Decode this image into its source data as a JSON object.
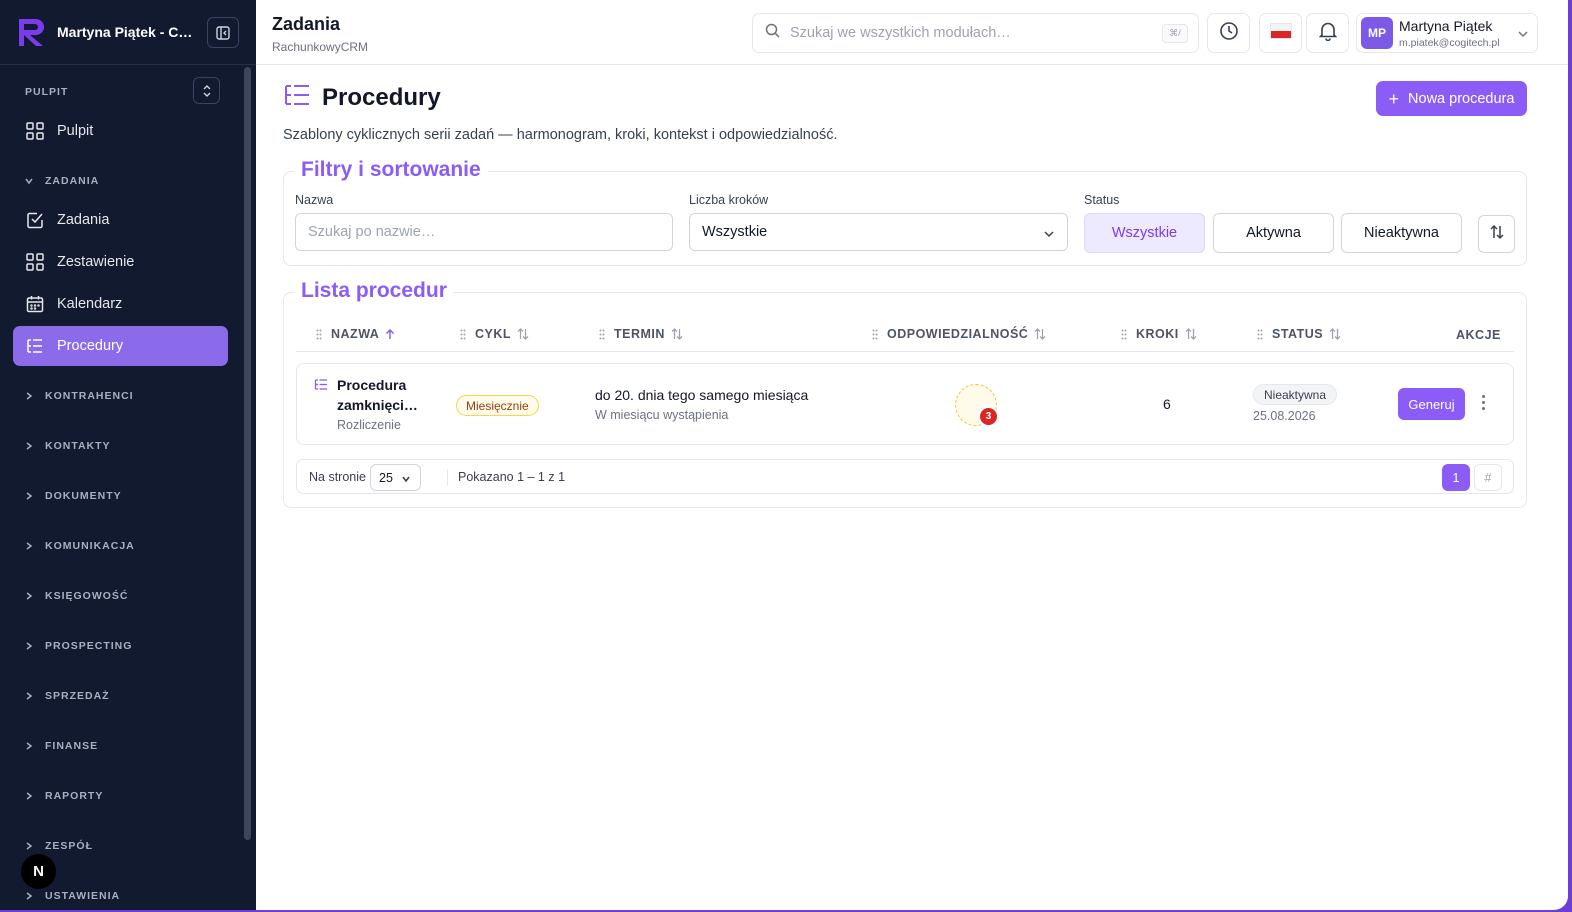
{
  "workspace": {
    "name": "Martyna Piątek - C…"
  },
  "sidebar": {
    "pulpit_label": "PULPIT",
    "pulpit_item": "Pulpit",
    "zadania_label": "ZADANIA",
    "items": [
      {
        "label": "Zadania",
        "icon": "check-square-icon"
      },
      {
        "label": "Zestawienie",
        "icon": "grid-icon"
      },
      {
        "label": "Kalendarz",
        "icon": "calendar-icon"
      },
      {
        "label": "Procedury",
        "icon": "list-tree-icon",
        "active": true
      }
    ],
    "groups": [
      "KONTRAHENCI",
      "KONTAKTY",
      "DOKUMENTY",
      "KOMUNIKACJA",
      "KSIĘGOWOŚĆ",
      "PROSPECTING",
      "SPRZEDAŻ",
      "FINANSE",
      "RAPORTY",
      "ZESPÓŁ",
      "USTAWIENIA"
    ],
    "next_badge": "N"
  },
  "topbar": {
    "title": "Zadania",
    "subtitle": "RachunkowyCRM",
    "search_placeholder": "Szukaj we wszystkich modułach…",
    "search_shortcut": "⌘/",
    "user_initials": "MP",
    "user_name": "Martyna Piątek",
    "user_email": "m.piatek@cogitech.pl"
  },
  "page": {
    "title": "Procedury",
    "description": "Szablony cyklicznych serii zadań — harmonogram, kroki, kontekst i odpowiedzialność.",
    "new_button": "Nowa procedura"
  },
  "filters": {
    "legend": "Filtry i sortowanie",
    "name_label": "Nazwa",
    "name_placeholder": "Szukaj po nazwie…",
    "steps_label": "Liczba kroków",
    "steps_value": "Wszystkie",
    "status_label": "Status",
    "status_options": [
      "Wszystkie",
      "Aktywna",
      "Nieaktywna"
    ],
    "status_selected": "Wszystkie"
  },
  "list": {
    "legend": "Lista procedur",
    "columns": {
      "name": "NAZWA",
      "cycle": "CYKL",
      "term": "TERMIN",
      "responsibility": "ODPOWIEDZIALNOŚĆ",
      "steps": "KROKI",
      "status": "STATUS",
      "actions": "AKCJE"
    },
    "rows": [
      {
        "name_line1": "Procedura",
        "name_line2": "zamknięci…",
        "category": "Rozliczenie",
        "cycle": "Miesięcznie",
        "term": "do 20. dnia tego samego miesiąca",
        "term_sub": "W miesiącu wystąpienia",
        "responsible_count": "3",
        "steps": "6",
        "status": "Nieaktywna",
        "status_date": "25.08.2026",
        "action": "Generuj"
      }
    ]
  },
  "pagination": {
    "per_page_label": "Na stronie",
    "per_page": "25",
    "info": "Pokazano 1 – 1 z 1",
    "current_page": "1",
    "jump": "#"
  },
  "colors": {
    "accent": "#8b5cf6",
    "sidebar_bg": "#111a2e",
    "badge_red": "#dc2626"
  }
}
